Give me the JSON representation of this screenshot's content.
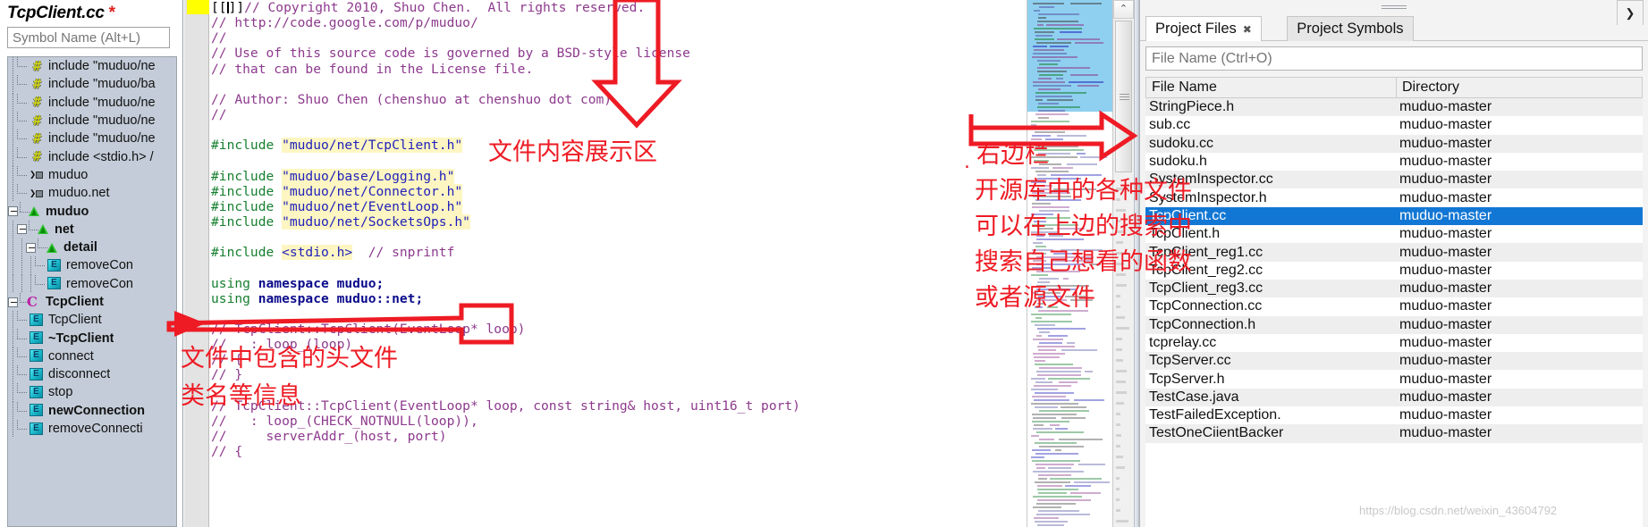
{
  "symbol_panel": {
    "title": "TcpClient.cc",
    "dirty_marker": "*",
    "search_placeholder": "Symbol Name (Alt+L)",
    "tree": [
      {
        "icon": "hash-include-icon",
        "label": "include \"muduo/ne",
        "bold": false,
        "depth": 1,
        "expander": false
      },
      {
        "icon": "hash-include-icon",
        "label": "include \"muduo/ba",
        "bold": false,
        "depth": 1,
        "expander": false
      },
      {
        "icon": "hash-include-icon",
        "label": "include \"muduo/ne",
        "bold": false,
        "depth": 1,
        "expander": false
      },
      {
        "icon": "hash-include-icon",
        "label": "include \"muduo/ne",
        "bold": false,
        "depth": 1,
        "expander": false
      },
      {
        "icon": "hash-include-icon",
        "label": "include \"muduo/ne",
        "bold": false,
        "depth": 1,
        "expander": false
      },
      {
        "icon": "hash-include-icon",
        "label": "include <stdio.h> /",
        "bold": false,
        "depth": 1,
        "expander": false
      },
      {
        "icon": "reference-icon",
        "label": "muduo",
        "bold": false,
        "depth": 1,
        "expander": false
      },
      {
        "icon": "reference-icon",
        "label": "muduo.net",
        "bold": false,
        "depth": 1,
        "expander": false
      },
      {
        "icon": "namespace-icon",
        "label": "muduo",
        "bold": true,
        "depth": 0,
        "expander": true
      },
      {
        "icon": "namespace-icon",
        "label": "net",
        "bold": true,
        "depth": 1,
        "expander": true
      },
      {
        "icon": "namespace-icon",
        "label": "detail",
        "bold": true,
        "depth": 2,
        "expander": true
      },
      {
        "icon": "function-icon",
        "label": "removeCon",
        "bold": false,
        "depth": 3,
        "expander": false
      },
      {
        "icon": "function-icon",
        "label": "removeCon",
        "bold": false,
        "depth": 3,
        "expander": false
      },
      {
        "icon": "class-icon",
        "label": "TcpClient",
        "bold": true,
        "depth": 0,
        "expander": true
      },
      {
        "icon": "function-icon",
        "label": "TcpClient",
        "bold": false,
        "depth": 1,
        "expander": false
      },
      {
        "icon": "function-icon",
        "label": "~TcpClient",
        "bold": true,
        "depth": 1,
        "expander": false
      },
      {
        "icon": "function-icon",
        "label": "connect",
        "bold": false,
        "depth": 1,
        "expander": false
      },
      {
        "icon": "function-icon",
        "label": "disconnect",
        "bold": false,
        "depth": 1,
        "expander": false
      },
      {
        "icon": "function-icon",
        "label": "stop",
        "bold": false,
        "depth": 1,
        "expander": false
      },
      {
        "icon": "function-icon",
        "label": "newConnection",
        "bold": true,
        "depth": 1,
        "expander": false
      },
      {
        "icon": "function-icon",
        "label": "removeConnecti",
        "bold": false,
        "depth": 1,
        "expander": false
      }
    ]
  },
  "editor": {
    "lines": [
      [
        {
          "t": "[[",
          "c": "pl"
        },
        {
          "t": "CARET",
          "c": "caret"
        },
        {
          "t": "]]",
          "c": "pl"
        },
        {
          "t": "// Copyright 2010, Shuo Chen.  All rights reserved.",
          "c": "cm"
        }
      ],
      [
        {
          "t": "// http://code.google.com/p/muduo/",
          "c": "cm"
        }
      ],
      [
        {
          "t": "//",
          "c": "cm"
        }
      ],
      [
        {
          "t": "// Use of this source code is governed by a BSD-style license",
          "c": "cm"
        }
      ],
      [
        {
          "t": "// that can be found in the License file.",
          "c": "cm"
        }
      ],
      [],
      [
        {
          "t": "// Author: Shuo Chen (chenshuo at chenshuo dot com)",
          "c": "cm"
        }
      ],
      [
        {
          "t": "//",
          "c": "cm"
        }
      ],
      [],
      [
        {
          "t": "#include ",
          "c": "pp"
        },
        {
          "t": "\"muduo/net/TcpClient.h\"",
          "c": "str"
        }
      ],
      [],
      [
        {
          "t": "#include ",
          "c": "pp"
        },
        {
          "t": "\"muduo/base/Logging.h\"",
          "c": "str"
        }
      ],
      [
        {
          "t": "#include ",
          "c": "pp"
        },
        {
          "t": "\"muduo/net/Connector.h\"",
          "c": "str"
        }
      ],
      [
        {
          "t": "#include ",
          "c": "pp"
        },
        {
          "t": "\"muduo/net/EventLoop.h\"",
          "c": "str"
        }
      ],
      [
        {
          "t": "#include ",
          "c": "pp"
        },
        {
          "t": "\"muduo/net/SocketsOps.h\"",
          "c": "str"
        }
      ],
      [],
      [
        {
          "t": "#include ",
          "c": "pp"
        },
        {
          "t": "<stdio.h>",
          "c": "str"
        },
        {
          "t": "  ",
          "c": "pl"
        },
        {
          "t": "// snprintf",
          "c": "cm"
        }
      ],
      [],
      [
        {
          "t": "using ",
          "c": "kw2"
        },
        {
          "t": "namespace muduo;",
          "c": "kw"
        }
      ],
      [
        {
          "t": "using ",
          "c": "kw2"
        },
        {
          "t": "namespace muduo::net;",
          "c": "kw"
        }
      ],
      [],
      [
        {
          "t": "// TcpClient::TcpClient(EventLoop* loop)",
          "c": "cm"
        }
      ],
      [
        {
          "t": "//   : loop_(loop)",
          "c": "cm"
        }
      ],
      [
        {
          "t": "// {",
          "c": "cm"
        }
      ],
      [
        {
          "t": "// }",
          "c": "cm"
        }
      ],
      [],
      [
        {
          "t": "// TcpClient::TcpClient(EventLoop* loop, const string& host, uint16_t port)",
          "c": "cm"
        }
      ],
      [
        {
          "t": "//   : loop_(CHECK_NOTNULL(loop)),",
          "c": "cm"
        }
      ],
      [
        {
          "t": "//     serverAddr_(host, port)",
          "c": "cm"
        }
      ],
      [
        {
          "t": "// {",
          "c": "cm"
        }
      ]
    ]
  },
  "scrollbar": {
    "up_arrow": "⌃"
  },
  "right_panel": {
    "tabs": [
      {
        "label": "Project Files",
        "active": true,
        "closable": true,
        "close_glyph": "✖"
      },
      {
        "label": "Project Symbols",
        "active": false,
        "closable": false,
        "close_glyph": ""
      }
    ],
    "tab_menu_glyph": "❯",
    "filter_placeholder": "File Name (Ctrl+O)",
    "columns": [
      "File Name",
      "Directory"
    ],
    "rows": [
      {
        "name": "StringPiece.h",
        "dir": "muduo-master",
        "selected": false
      },
      {
        "name": "sub.cc",
        "dir": "muduo-master",
        "selected": false
      },
      {
        "name": "sudoku.cc",
        "dir": "muduo-master",
        "selected": false
      },
      {
        "name": "sudoku.h",
        "dir": "muduo-master",
        "selected": false
      },
      {
        "name": "SystemInspector.cc",
        "dir": "muduo-master",
        "selected": false
      },
      {
        "name": "SystemInspector.h",
        "dir": "muduo-master",
        "selected": false
      },
      {
        "name": "TcpClient.cc",
        "dir": "muduo-master",
        "selected": true
      },
      {
        "name": "TcpClient.h",
        "dir": "muduo-master",
        "selected": false
      },
      {
        "name": "TcpClient_reg1.cc",
        "dir": "muduo-master",
        "selected": false
      },
      {
        "name": "TcpClient_reg2.cc",
        "dir": "muduo-master",
        "selected": false
      },
      {
        "name": "TcpClient_reg3.cc",
        "dir": "muduo-master",
        "selected": false
      },
      {
        "name": "TcpConnection.cc",
        "dir": "muduo-master",
        "selected": false
      },
      {
        "name": "TcpConnection.h",
        "dir": "muduo-master",
        "selected": false
      },
      {
        "name": "tcprelay.cc",
        "dir": "muduo-master",
        "selected": false
      },
      {
        "name": "TcpServer.cc",
        "dir": "muduo-master",
        "selected": false
      },
      {
        "name": "TcpServer.h",
        "dir": "muduo-master",
        "selected": false
      },
      {
        "name": "TestCase.java",
        "dir": "muduo-master",
        "selected": false
      },
      {
        "name": "TestFailedException.",
        "dir": "muduo-master",
        "selected": false
      },
      {
        "name": "TestOneCiientBacker",
        "dir": "muduo-master",
        "selected": false
      }
    ]
  },
  "annotations": {
    "color": "#ee1b24",
    "content_area_label": "文件内容展示区",
    "headers_label_line1": "文件中包含的头文件",
    "headers_label_line2": "类名等信息",
    "right_panel_label_line1": "右边栏",
    "right_panel_label_line2": "开源库中的各种文件",
    "right_panel_label_line3": "可以在上边的搜索中",
    "right_panel_label_line4": "搜索自己想看的函数",
    "right_panel_label_line5": "或者源文件",
    "bullet": "."
  },
  "watermark": {
    "text": "https://blog.csdn.net/weixin_43604792"
  }
}
